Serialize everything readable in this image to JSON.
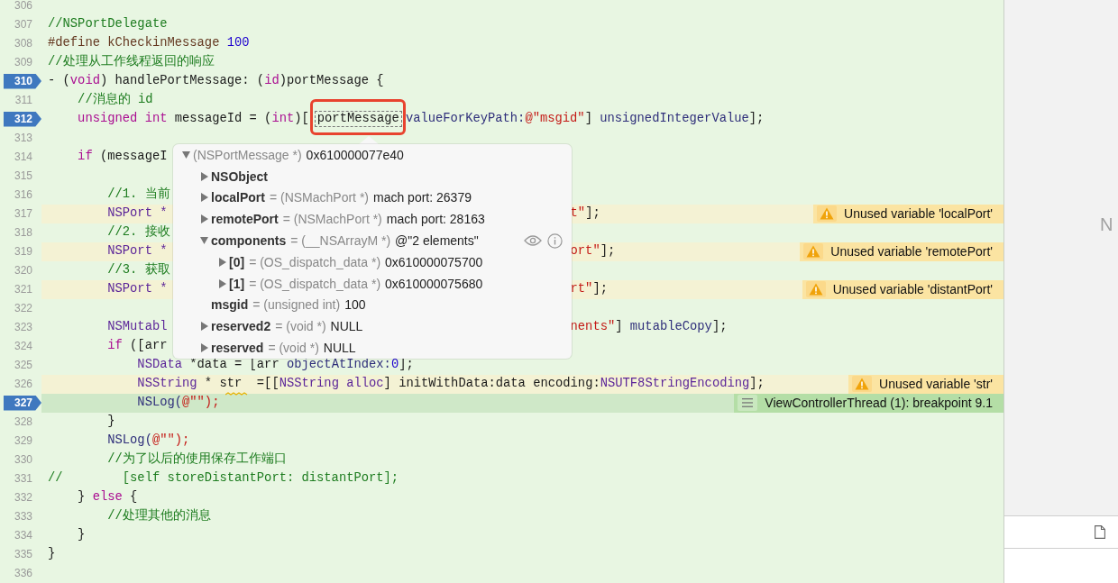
{
  "editor": {
    "lines": [
      {
        "number": "306",
        "breakpoint": false,
        "current": false
      },
      {
        "number": "307",
        "breakpoint": false,
        "current": false,
        "tokens": [
          {
            "text": "//NSPortDelegate",
            "color": "#1d7c1f"
          }
        ]
      },
      {
        "number": "308",
        "breakpoint": false,
        "current": false,
        "tokens": [
          {
            "text": "#define kCheckinMessage ",
            "color": "#643820"
          },
          {
            "text": "100",
            "color": "#1c00cf"
          }
        ]
      },
      {
        "number": "309",
        "breakpoint": false,
        "current": false,
        "tokens": [
          {
            "text": "//处理从工作线程返回的响应",
            "color": "#1d7c1f"
          }
        ]
      },
      {
        "number": "310",
        "breakpoint": true,
        "current": false,
        "tokens": [
          {
            "text": "- (",
            "color": "#1a1a1a"
          },
          {
            "text": "void",
            "color": "#aa0d91"
          },
          {
            "text": ") handlePortMessage: (",
            "color": "#1a1a1a"
          },
          {
            "text": "id",
            "color": "#aa0d91"
          },
          {
            "text": ")portMessage {",
            "color": "#1a1a1a"
          }
        ]
      },
      {
        "number": "311",
        "breakpoint": false,
        "current": false,
        "tokens": [
          {
            "text": "    //消息的 id",
            "color": "#1d7c1f"
          }
        ]
      },
      {
        "number": "312",
        "breakpoint": true,
        "current": false,
        "tokens": [
          {
            "kind": "code",
            "text": "    unsigned int",
            "color": "#aa0d91"
          },
          {
            "kind": "code",
            "text": " messageId = (",
            "color": "#1a1a1a"
          },
          {
            "kind": "code",
            "text": "int",
            "color": "#aa0d91"
          },
          {
            "kind": "code",
            "text": ")[",
            "color": "#1a1a1a"
          },
          {
            "kind": "highlighted",
            "text": "portMessage",
            "color": "#1a1a1a"
          },
          {
            "kind": "code",
            "text": "valueForKeyPath:",
            "color": "#2e2e7a"
          },
          {
            "kind": "code",
            "text": "@\"msgid\"",
            "color": "#c41a16"
          },
          {
            "kind": "code",
            "text": "] ",
            "color": "#1a1a1a"
          },
          {
            "kind": "code",
            "text": "unsignedIntegerValue",
            "color": "#2e2e7a"
          },
          {
            "kind": "code",
            "text": "];",
            "color": "#1a1a1a"
          }
        ]
      },
      {
        "number": "313",
        "breakpoint": false,
        "current": false
      },
      {
        "number": "314",
        "breakpoint": false,
        "current": false,
        "tokens": [
          {
            "text": "    if",
            "color": "#aa0d91"
          },
          {
            "text": " (messageI",
            "color": "#1a1a1a"
          }
        ]
      },
      {
        "number": "315",
        "breakpoint": false,
        "current": false
      },
      {
        "number": "316",
        "breakpoint": false,
        "current": false,
        "tokens": [
          {
            "text": "        //1. 当前",
            "color": "#1d7c1f"
          }
        ]
      },
      {
        "number": "317",
        "breakpoint": false,
        "current": false,
        "tokens": [
          {
            "text": "        NSPort *",
            "color": "#5c2699"
          }
        ],
        "tail": [
          {
            "text": "t\"",
            "color": "#c41a16"
          },
          {
            "text": "];",
            "color": "#1a1a1a"
          }
        ],
        "annotation": {
          "kind": "warning",
          "text": "Unused variable 'localPort'"
        }
      },
      {
        "number": "318",
        "breakpoint": false,
        "current": false,
        "tokens": [
          {
            "text": "        //2. 接收",
            "color": "#1d7c1f"
          }
        ]
      },
      {
        "number": "319",
        "breakpoint": false,
        "current": false,
        "tokens": [
          {
            "text": "        NSPort *",
            "color": "#5c2699"
          }
        ],
        "tail": [
          {
            "text": "ort\"",
            "color": "#c41a16"
          },
          {
            "text": "];",
            "color": "#1a1a1a"
          }
        ],
        "annotation": {
          "kind": "warning",
          "text": "Unused variable 'remotePort'"
        }
      },
      {
        "number": "320",
        "breakpoint": false,
        "current": false,
        "tokens": [
          {
            "text": "        //3. 获取",
            "color": "#1d7c1f"
          }
        ]
      },
      {
        "number": "321",
        "breakpoint": false,
        "current": false,
        "tokens": [
          {
            "text": "        NSPort *",
            "color": "#5c2699"
          }
        ],
        "tail": [
          {
            "text": "rt\"",
            "color": "#c41a16"
          },
          {
            "text": "];",
            "color": "#1a1a1a"
          }
        ],
        "annotation": {
          "kind": "warning",
          "text": "Unused variable 'distantPort'"
        }
      },
      {
        "number": "322",
        "breakpoint": false,
        "current": false
      },
      {
        "number": "323",
        "breakpoint": false,
        "current": false,
        "tokens": [
          {
            "text": "        NSMutabl",
            "color": "#5c2699"
          }
        ],
        "tail": [
          {
            "text": "nents\"",
            "color": "#c41a16"
          },
          {
            "text": "] ",
            "color": "#1a1a1a"
          },
          {
            "text": "mutableCopy",
            "color": "#2e2e7a"
          },
          {
            "text": "];",
            "color": "#1a1a1a"
          }
        ]
      },
      {
        "number": "324",
        "breakpoint": false,
        "current": false,
        "tokens": [
          {
            "text": "        if",
            "color": "#aa0d91"
          },
          {
            "text": " ([arr",
            "color": "#1a1a1a"
          }
        ]
      },
      {
        "number": "325",
        "breakpoint": false,
        "current": false,
        "tokens": [
          {
            "text": "            NSData",
            "color": "#5c2699"
          },
          {
            "text": " *data = [arr ",
            "color": "#1a1a1a"
          },
          {
            "text": "objectAtIndex:",
            "color": "#2e2e7a"
          },
          {
            "text": "0",
            "color": "#1c00cf"
          },
          {
            "text": "];",
            "color": "#1a1a1a"
          }
        ]
      },
      {
        "number": "326",
        "breakpoint": false,
        "current": false,
        "tokens": [
          {
            "text": "            NSString",
            "color": "#5c2699"
          },
          {
            "text": " * str  =[[",
            "color": "#1a1a1a"
          },
          {
            "text": "NSString alloc",
            "color": "#5c2699"
          },
          {
            "text": "] initWithData:data encoding:",
            "color": "#1a1a1a"
          },
          {
            "text": "NSUTF8StringEncoding",
            "color": "#5c2699"
          },
          {
            "text": "];",
            "color": "#1a1a1a"
          }
        ],
        "annotation": {
          "kind": "warning",
          "text": "Unused variable 'str'"
        }
      },
      {
        "number": "327",
        "breakpoint": true,
        "current": true,
        "tokens": [
          {
            "text": "            NSLog(",
            "color": "#2e2e7a"
          },
          {
            "text": "@\"\");",
            "color": "#c41a16"
          }
        ],
        "annotation": {
          "kind": "breakpoint",
          "text": "ViewControllerThread (1): breakpoint 9.1"
        }
      },
      {
        "number": "328",
        "breakpoint": false,
        "current": false,
        "tokens": [
          {
            "text": "        }",
            "color": "#1a1a1a"
          }
        ]
      },
      {
        "number": "329",
        "breakpoint": false,
        "current": false,
        "tokens": [
          {
            "text": "        NSLog(",
            "color": "#2e2e7a"
          },
          {
            "text": "@\"\");",
            "color": "#c41a16"
          }
        ]
      },
      {
        "number": "330",
        "breakpoint": false,
        "current": false,
        "tokens": [
          {
            "text": "        //为了以后的使用保存工作端口",
            "color": "#1d7c1f"
          }
        ]
      },
      {
        "number": "331",
        "breakpoint": false,
        "current": false,
        "tokens": [
          {
            "text": "//        [self storeDistantPort: distantPort];",
            "color": "#1d7c1f"
          }
        ]
      },
      {
        "number": "332",
        "breakpoint": false,
        "current": false,
        "tokens": [
          {
            "text": "    } ",
            "color": "#1a1a1a"
          },
          {
            "text": "else",
            "color": "#aa0d91"
          },
          {
            "text": " {",
            "color": "#1a1a1a"
          }
        ]
      },
      {
        "number": "333",
        "breakpoint": false,
        "current": false,
        "tokens": [
          {
            "text": "        //处理其他的消息",
            "color": "#1d7c1f"
          }
        ]
      },
      {
        "number": "334",
        "breakpoint": false,
        "current": false,
        "tokens": [
          {
            "text": "    }",
            "color": "#1a1a1a"
          }
        ]
      },
      {
        "number": "335",
        "breakpoint": false,
        "current": false,
        "tokens": [
          {
            "text": "}",
            "color": "#1a1a1a"
          }
        ]
      },
      {
        "number": "336",
        "breakpoint": false,
        "current": false
      }
    ]
  },
  "popover": {
    "rows": [
      {
        "kind": "group",
        "expanded": true,
        "detail": "(NSPortMessage *)",
        "value": "0x610000077e40",
        "children": [
          {
            "kind": "group",
            "expanded": false,
            "name": "NSObject"
          },
          {
            "kind": "group",
            "expanded": false,
            "name": "localPort",
            "detail": "= (NSMachPort *)",
            "value": "mach port: 26379"
          },
          {
            "kind": "group",
            "expanded": false,
            "name": "remotePort",
            "detail": "= (NSMachPort *)",
            "value": "mach port: 28163"
          },
          {
            "kind": "group",
            "expanded": true,
            "name": "components",
            "detail": "= (__NSArrayM *)",
            "value": "@\"2 elements\"",
            "actions": true,
            "children": [
              {
                "kind": "group",
                "expanded": false,
                "name": "[0]",
                "detail": "= (OS_dispatch_data *)",
                "value": "0x610000075700"
              },
              {
                "kind": "group",
                "expanded": false,
                "name": "[1]",
                "detail": "= (OS_dispatch_data *)",
                "value": "0x610000075680"
              }
            ]
          },
          {
            "kind": "value",
            "name": "msgid",
            "detail": "= (unsigned int)",
            "value": "100"
          },
          {
            "kind": "group",
            "expanded": false,
            "name": "reserved2",
            "detail": "= (void *)",
            "value": "NULL"
          },
          {
            "kind": "group",
            "expanded": false,
            "name": "reserved",
            "detail": "= (void *)",
            "value": "NULL"
          }
        ]
      }
    ]
  },
  "inspector": {
    "placeholder_text": "N"
  }
}
